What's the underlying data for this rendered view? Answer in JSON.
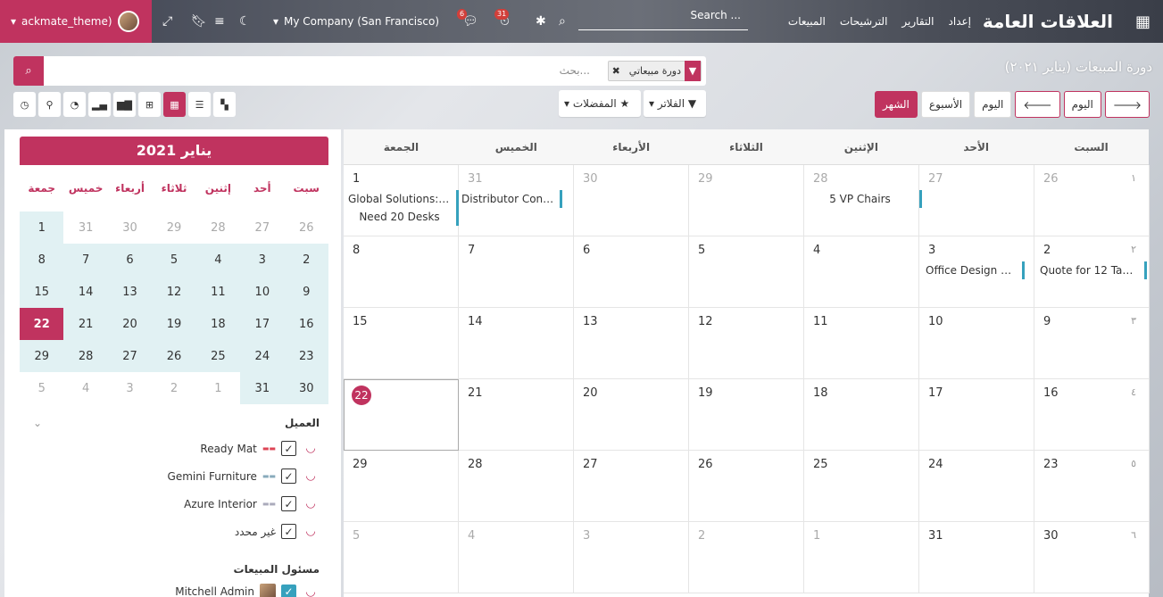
{
  "navbar": {
    "user": "ackmate_theme)",
    "company": "My Company (San Francisco)",
    "search_placeholder": "Search ...",
    "badge_chat": "6",
    "badge_activity": "31",
    "menu": [
      "المبيعات",
      "الترشيحات",
      "التقارير",
      "إعداد"
    ],
    "app_title": "العلاقات العامة"
  },
  "breadcrumb": "دورة المبيعات (يناير ٢٠٢١)",
  "search": {
    "placeholder": "بحث...",
    "facet": "دورة مبيعاتي"
  },
  "controls": {
    "filters": "الفلاتر",
    "favorites": "المفضلات"
  },
  "nav": {
    "today": "اليوم",
    "day": "اليوم",
    "week": "الأسبوع",
    "month": "الشهر"
  },
  "mini_calendar": {
    "title": "يناير 2021",
    "days": [
      "سبت",
      "أحد",
      "إثنين",
      "ثلاثاء",
      "أربعاء",
      "خميس",
      "جمعة"
    ],
    "rows": [
      [
        "26",
        "27",
        "28",
        "29",
        "30",
        "31",
        "1"
      ],
      [
        "2",
        "3",
        "4",
        "5",
        "6",
        "7",
        "8"
      ],
      [
        "9",
        "10",
        "11",
        "12",
        "13",
        "14",
        "15"
      ],
      [
        "16",
        "17",
        "18",
        "19",
        "20",
        "21",
        "22"
      ],
      [
        "23",
        "24",
        "25",
        "26",
        "27",
        "28",
        "29"
      ],
      [
        "30",
        "31",
        "1",
        "2",
        "3",
        "4",
        "5"
      ]
    ]
  },
  "filters": {
    "customer_title": "العميل",
    "customers": [
      "Ready Mat",
      "Gemini Furniture",
      "Azure Interior",
      "غير محدد"
    ],
    "salesperson_title": "مسئول المبيعات",
    "salesperson": "Mitchell Admin"
  },
  "calendar": {
    "weekdays": [
      "السبت",
      "الأحد",
      "الإثنين",
      "الثلاثاء",
      "الأربعاء",
      "الخميس",
      "الجمعة"
    ],
    "weeks": [
      {
        "num": "١",
        "days": [
          "26",
          "27",
          "28",
          "29",
          "30",
          "31",
          "1"
        ]
      },
      {
        "num": "٢",
        "days": [
          "2",
          "3",
          "4",
          "5",
          "6",
          "7",
          "8"
        ]
      },
      {
        "num": "٣",
        "days": [
          "9",
          "10",
          "11",
          "12",
          "13",
          "14",
          "15"
        ]
      },
      {
        "num": "٤",
        "days": [
          "16",
          "17",
          "18",
          "19",
          "20",
          "21",
          "22"
        ]
      },
      {
        "num": "٥",
        "days": [
          "23",
          "24",
          "25",
          "26",
          "27",
          "28",
          "29"
        ]
      },
      {
        "num": "٦",
        "days": [
          "30",
          "31",
          "1",
          "2",
          "3",
          "4",
          "5"
        ]
      }
    ],
    "events": {
      "e1": "5 VP Chairs",
      "e2": "Distributor Contr...",
      "e3": "Global Solutions: ...",
      "e4": "Need 20 Desks",
      "e5": "Quote for 12 Tabl...",
      "e6": "Office Design an..."
    }
  },
  "colors": {
    "accent": "#c0335f",
    "event_bar": "#36a1bd"
  }
}
